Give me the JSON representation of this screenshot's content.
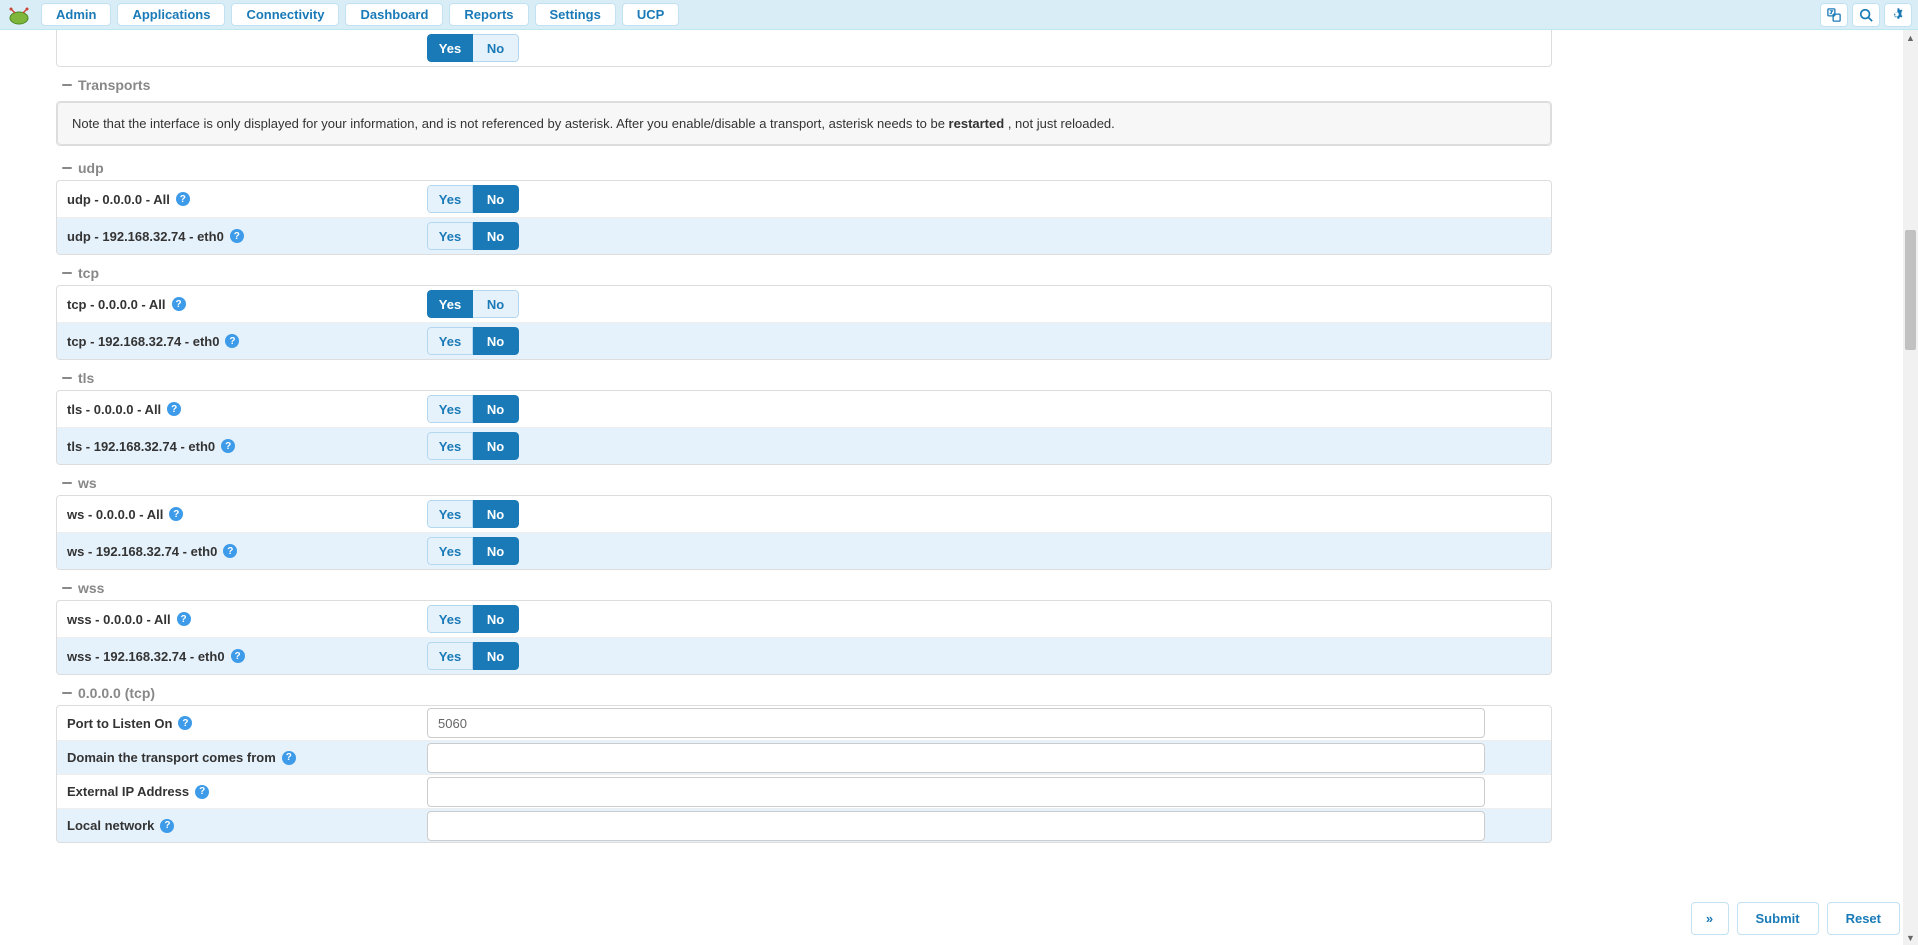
{
  "nav": {
    "items": [
      "Admin",
      "Applications",
      "Connectivity",
      "Dashboard",
      "Reports",
      "Settings",
      "UCP"
    ]
  },
  "toolbar_yes": "Yes",
  "toolbar_no": "No",
  "transports_title": "Transports",
  "info_prefix": "Note that the interface is only displayed for your information, and is not referenced by asterisk. After you enable/disable a transport, asterisk needs to be ",
  "info_bold": "restarted",
  "info_suffix": ", not just reloaded.",
  "groups": [
    {
      "name": "udp",
      "rows": [
        {
          "label": "udp - 0.0.0.0 - All",
          "active": "No"
        },
        {
          "label": "udp - 192.168.32.74 - eth0",
          "active": "No"
        }
      ]
    },
    {
      "name": "tcp",
      "rows": [
        {
          "label": "tcp - 0.0.0.0 - All",
          "active": "Yes"
        },
        {
          "label": "tcp - 192.168.32.74 - eth0",
          "active": "No"
        }
      ]
    },
    {
      "name": "tls",
      "rows": [
        {
          "label": "tls - 0.0.0.0 - All",
          "active": "No"
        },
        {
          "label": "tls - 192.168.32.74 - eth0",
          "active": "No"
        }
      ]
    },
    {
      "name": "ws",
      "rows": [
        {
          "label": "ws - 0.0.0.0 - All",
          "active": "No"
        },
        {
          "label": "ws - 192.168.32.74 - eth0",
          "active": "No"
        }
      ]
    },
    {
      "name": "wss",
      "rows": [
        {
          "label": "wss - 0.0.0.0 - All",
          "active": "No"
        },
        {
          "label": "wss - 192.168.32.74 - eth0",
          "active": "No"
        }
      ]
    }
  ],
  "tcp_section_name": "0.0.0.0 (tcp)",
  "tcp_fields": {
    "port_label": "Port to Listen On",
    "port_value": "5060",
    "domain_label": "Domain the transport comes from",
    "domain_value": "",
    "extip_label": "External IP Address",
    "extip_value": "",
    "localnet_label": "Local network",
    "localnet_value": ""
  },
  "yes": "Yes",
  "no": "No",
  "footer": {
    "submit": "Submit",
    "reset": "Reset"
  }
}
